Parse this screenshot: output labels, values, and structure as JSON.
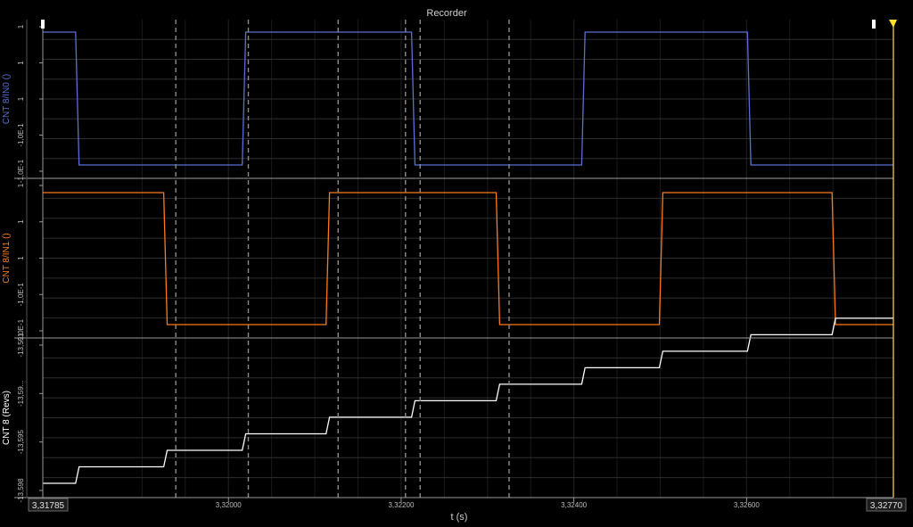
{
  "window": {
    "title": "Recorder"
  },
  "colors": {
    "background": "#000000",
    "grid": "#2e2e2e",
    "axis": "#9a9a9a",
    "cursor_line": "#8c8c8c",
    "marker": "#ffe033"
  },
  "chart_data": [
    {
      "type": "line",
      "ylabel": "CNT 8/IN0 ()",
      "color": "#5b6fd6",
      "y_ticks": [
        "1",
        "1",
        "1",
        "-1,0E-1",
        "-1,0E-1"
      ],
      "ylim": [
        -0.1,
        1
      ],
      "x": [
        3.31785,
        3.31823,
        3.31827,
        3.32016,
        3.3202,
        3.32212,
        3.32216,
        3.32409,
        3.32413,
        3.32601,
        3.32605,
        3.3277
      ],
      "y": [
        1,
        1,
        -0.1,
        -0.1,
        1,
        1,
        -0.1,
        -0.1,
        1,
        1,
        -0.1,
        -0.1
      ]
    },
    {
      "type": "line",
      "ylabel": "CNT 8/IN1 ()",
      "color": "#ff7a1a",
      "y_ticks": [
        "1",
        "1",
        "1",
        "-1,0E-1",
        "-1,0E-1"
      ],
      "ylim": [
        -0.1,
        1
      ],
      "x": [
        3.31785,
        3.31925,
        3.31929,
        3.32113,
        3.32117,
        3.3231,
        3.32314,
        3.32499,
        3.32503,
        3.32699,
        3.32703,
        3.3277
      ],
      "y": [
        1,
        1,
        -0.1,
        -0.1,
        1,
        1,
        -0.1,
        -0.1,
        1,
        1,
        -0.1,
        -0.1
      ]
    },
    {
      "type": "line",
      "ylabel": "CNT 8 (Revs)",
      "color": "#ffffff",
      "y_ticks": [
        "-13,591",
        "-13,59...",
        "-13,595",
        "-13,598"
      ],
      "ylim": [
        -13.5985,
        -13.5915
      ],
      "x": [
        3.31785,
        3.31823,
        3.31827,
        3.31925,
        3.31929,
        3.32016,
        3.3202,
        3.32113,
        3.32117,
        3.32212,
        3.32216,
        3.3231,
        3.32314,
        3.32409,
        3.32413,
        3.32499,
        3.32503,
        3.32601,
        3.32605,
        3.32699,
        3.32703,
        3.3277
      ],
      "y": [
        -13.5985,
        -13.5985,
        -13.5977,
        -13.5977,
        -13.5969,
        -13.5969,
        -13.5961,
        -13.5961,
        -13.5953,
        -13.5953,
        -13.5945,
        -13.5945,
        -13.5937,
        -13.5937,
        -13.5929,
        -13.5929,
        -13.5921,
        -13.5921,
        -13.5913,
        -13.5913,
        -13.5905,
        -13.5905
      ]
    }
  ],
  "x_axis": {
    "label": "t (s)",
    "xlim": [
      3.31785,
      3.3277
    ],
    "ticks": [
      {
        "value": 3.32,
        "label": "3,32000"
      },
      {
        "value": 3.322,
        "label": "3,32200"
      },
      {
        "value": 3.324,
        "label": "3,32400"
      },
      {
        "value": 3.326,
        "label": "3,32600"
      }
    ],
    "start_label": "3,31785",
    "end_label": "3,32770"
  },
  "cursors": [
    3.31939,
    3.32023,
    3.32127,
    3.32205,
    3.32222,
    3.32325
  ]
}
